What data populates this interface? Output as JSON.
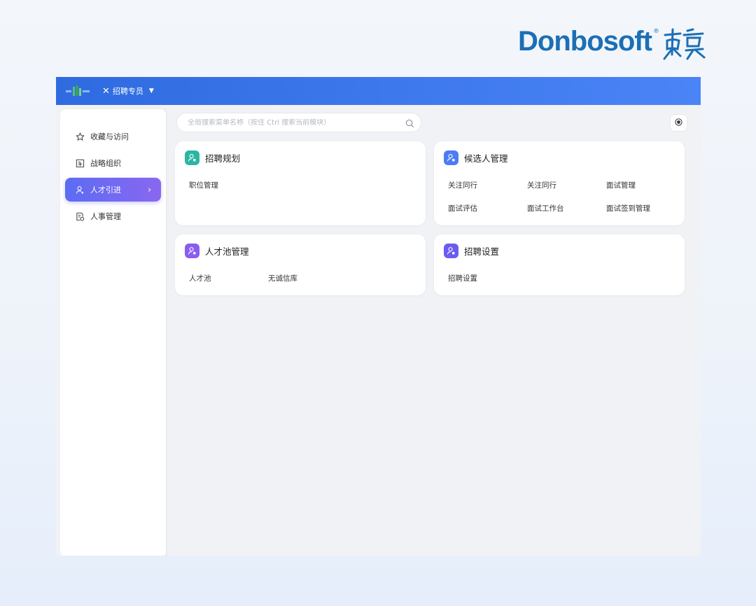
{
  "brand": {
    "name": "Donbosoft",
    "reg_mark": "®",
    "seal_text": "東寶",
    "color": "#1c6fb5"
  },
  "topbar": {
    "close_icon": "close-icon",
    "role_label": "招聘专员",
    "caret_icon": "caret-down-icon",
    "gradient": [
      "#2f6be0",
      "#4a84f7"
    ]
  },
  "sidebar": {
    "items": [
      {
        "label": "收藏与访问",
        "icon": "star-icon",
        "active": false
      },
      {
        "label": "战略组织",
        "icon": "org-chart-icon",
        "active": false
      },
      {
        "label": "人才引进",
        "icon": "person-add-icon",
        "active": true
      },
      {
        "label": "人事管理",
        "icon": "personnel-file-icon",
        "active": false
      }
    ],
    "active_chevron": "›",
    "active_gradient": [
      "#5b6cf3",
      "#8a67f0"
    ]
  },
  "search": {
    "placeholder": "全局搜索菜单名称（按住 Ctrl 搜索当前模块）",
    "value": ""
  },
  "cards": [
    {
      "title": "招聘规划",
      "icon_color": "#2bb6a3",
      "links": [
        "职位管理"
      ]
    },
    {
      "title": "候选人管理",
      "icon_color": "#4b7cf3",
      "links": [
        "关注同行",
        "关注同行",
        "面试管理",
        "面试评估",
        "面试工作台",
        "面试签到管理"
      ]
    },
    {
      "title": "人才池管理",
      "icon_color": "#8a5cf0",
      "links": [
        "人才池",
        "无诚信库"
      ]
    },
    {
      "title": "招聘设置",
      "icon_color": "#6a5cf0",
      "links": [
        "招聘设置"
      ]
    }
  ]
}
